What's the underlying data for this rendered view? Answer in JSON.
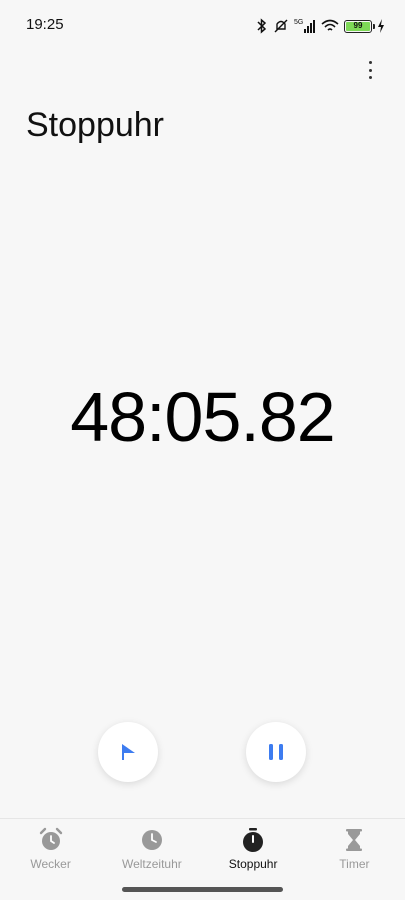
{
  "status_bar": {
    "time": "19:25",
    "network": "5G",
    "battery_level": "99",
    "icons": [
      "bluetooth-icon",
      "mute-icon",
      "signal-icon",
      "wifi-icon",
      "battery-icon",
      "charging-icon"
    ]
  },
  "header": {
    "title": "Stoppuhr",
    "menu_icon": "more-vertical-icon"
  },
  "stopwatch": {
    "elapsed": "48:05.82"
  },
  "controls": {
    "lap_icon": "flag-icon",
    "pause_icon": "pause-icon",
    "accent_color": "#3d7cf0"
  },
  "bottom_nav": {
    "items": [
      {
        "label": "Wecker",
        "icon": "alarm-clock-icon"
      },
      {
        "label": "Weltzeituhr",
        "icon": "clock-icon"
      },
      {
        "label": "Stoppuhr",
        "icon": "stopwatch-icon",
        "active": true
      },
      {
        "label": "Timer",
        "icon": "hourglass-icon"
      }
    ]
  }
}
